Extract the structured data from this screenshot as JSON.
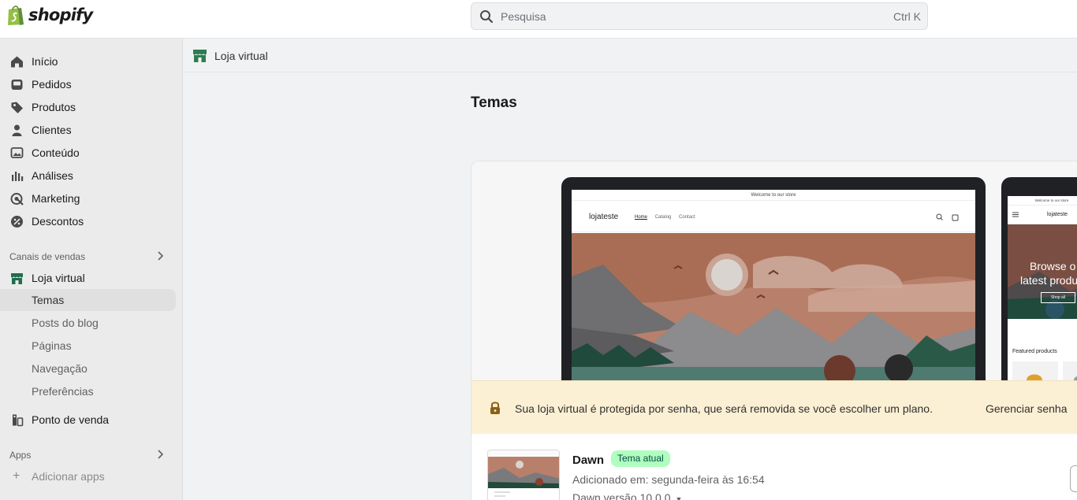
{
  "topbar": {
    "logo_text": "shopify",
    "search": {
      "placeholder": "Pesquisa",
      "shortcut": "Ctrl K"
    }
  },
  "sidebar": {
    "items": [
      {
        "label": "Início",
        "icon": "home-icon"
      },
      {
        "label": "Pedidos",
        "icon": "inbox-icon"
      },
      {
        "label": "Produtos",
        "icon": "tag-icon"
      },
      {
        "label": "Clientes",
        "icon": "person-icon"
      },
      {
        "label": "Conteúdo",
        "icon": "image-icon"
      },
      {
        "label": "Análises",
        "icon": "bar-chart-icon"
      },
      {
        "label": "Marketing",
        "icon": "target-icon"
      },
      {
        "label": "Descontos",
        "icon": "discount-icon"
      }
    ],
    "sales_channels_label": "Canais de vendas",
    "online_store": {
      "label": "Loja virtual",
      "icon": "store-icon",
      "sub_items": [
        "Temas",
        "Posts do blog",
        "Páginas",
        "Navegação",
        "Preferências"
      ],
      "active": "Temas"
    },
    "pos": {
      "label": "Ponto de venda",
      "icon": "pos-icon"
    },
    "apps_label": "Apps",
    "add_apps_label": "Adicionar apps"
  },
  "subheader": {
    "label": "Loja virtual"
  },
  "page": {
    "title": "Temas"
  },
  "preview": {
    "announcement": "Welcome to our store",
    "store_name": "lojateste",
    "nav": [
      "Home",
      "Catalog",
      "Contact"
    ],
    "phone_announcement": "Welcome to our store",
    "phone_store_name": "lojateste",
    "phone_hero_line1": "Browse o",
    "phone_hero_line2": "latest produ",
    "phone_shop_label": "Shop all",
    "phone_featured": "Featured products"
  },
  "alert": {
    "text": "Sua loja virtual é protegida por senha, que será removida se você escolher um plano.",
    "link": "Gerenciar senha"
  },
  "theme": {
    "name": "Dawn",
    "badge": "Tema atual",
    "added": "Adicionado em: segunda-feira às 16:54",
    "version": "Dawn versão 10.0.0"
  },
  "colors": {
    "accent_green": "#008060",
    "badge_bg": "#affebf",
    "alert_bg": "#fcf0d4"
  }
}
